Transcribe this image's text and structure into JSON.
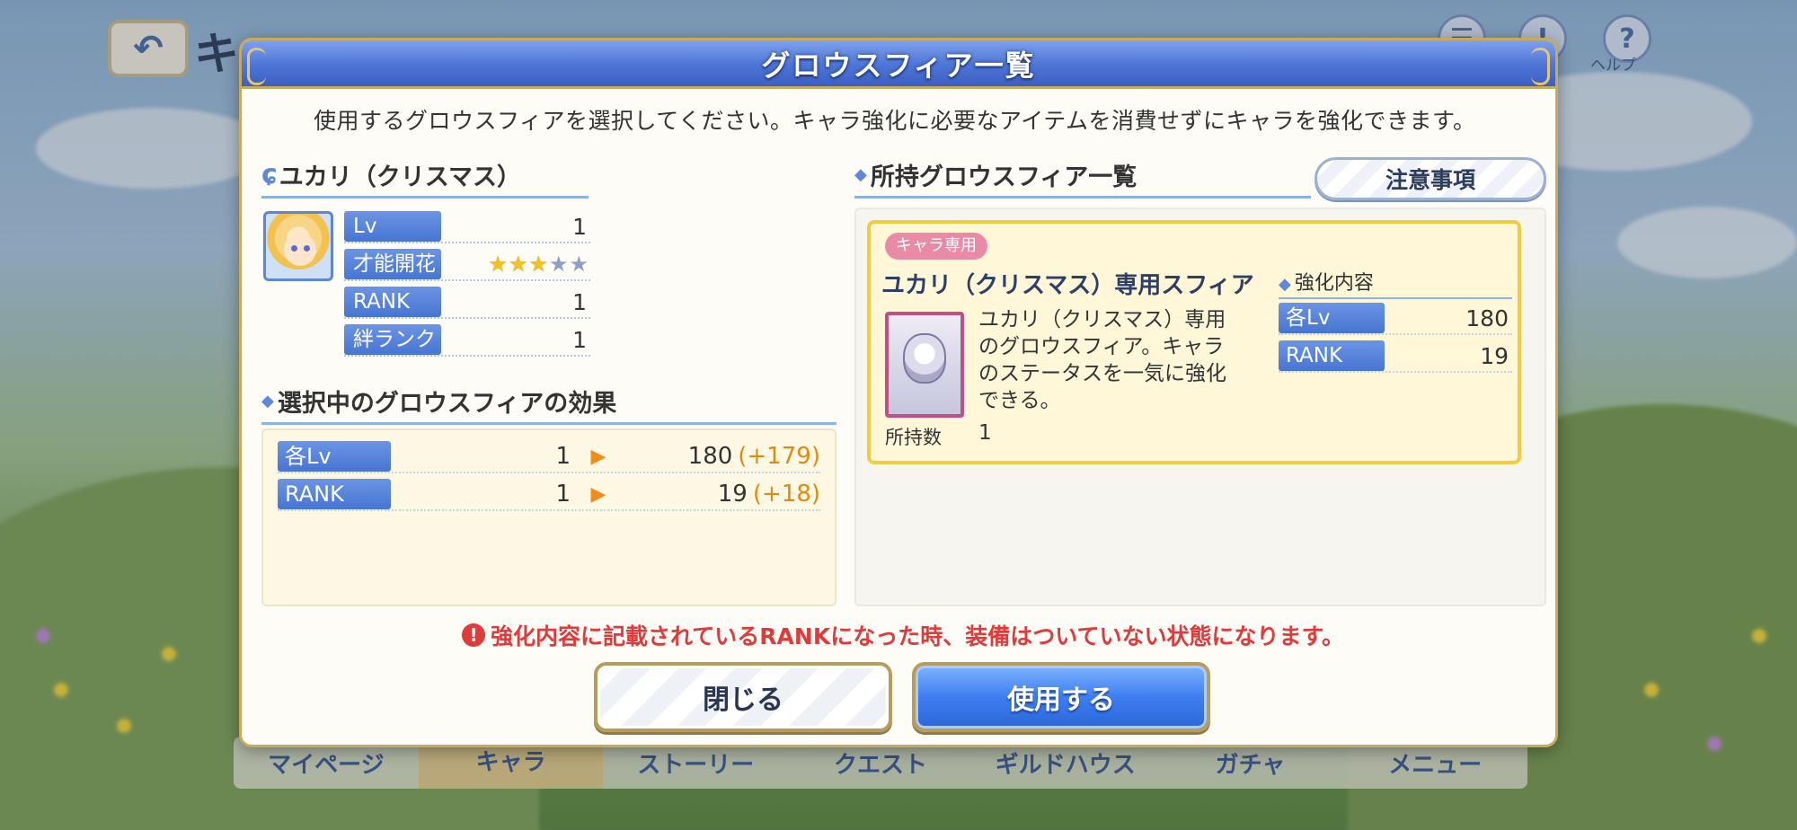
{
  "background": {
    "title_char": "キ",
    "help_label": "ヘルプ",
    "nav_items": [
      "マイページ",
      "キャラ",
      "ストーリー",
      "クエスト",
      "ギルドハウス",
      "ガチャ",
      "メニュー"
    ]
  },
  "modal": {
    "title": "グロウスフィア一覧",
    "description": "使用するグロウスフィアを選択してください。キャラ強化に必要なアイテムを消費せずにキャラを強化できます。"
  },
  "character": {
    "name": "ユカリ（クリスマス）",
    "stats": [
      {
        "label": "Lv",
        "value": "1"
      },
      {
        "label": "才能開花",
        "stars_on": 3,
        "stars_total": 5
      },
      {
        "label": "RANK",
        "value": "1"
      },
      {
        "label": "絆ランク",
        "value": "1"
      }
    ]
  },
  "effect": {
    "title": "選択中のグロウスフィアの効果",
    "rows": [
      {
        "label": "各Lv",
        "from": "1",
        "to": "180",
        "diff": "(+179)"
      },
      {
        "label": "RANK",
        "from": "1",
        "to": "19",
        "diff": "(+18)"
      }
    ]
  },
  "owned": {
    "title": "所持グロウスフィア一覧",
    "caution_button": "注意事項",
    "card": {
      "tag": "キャラ専用",
      "name": "ユカリ（クリスマス）専用スフィア",
      "description": "ユカリ（クリスマス）専用のグロウスフィア。キャラのステータスを一気に強化できる。",
      "count_label": "所持数",
      "count_value": "1",
      "boost_title": "強化内容",
      "boosts": [
        {
          "label": "各Lv",
          "value": "180"
        },
        {
          "label": "RANK",
          "value": "19"
        }
      ]
    }
  },
  "warning": "強化内容に記載されているRANKになった時、装備はついていない状態になります。",
  "buttons": {
    "close": "閉じる",
    "use": "使用する"
  },
  "colors": {
    "accent_blue": "#4775d2",
    "warning_red": "#e13a3a",
    "diff_orange": "#e08a14",
    "card_border": "#f0cd40"
  }
}
